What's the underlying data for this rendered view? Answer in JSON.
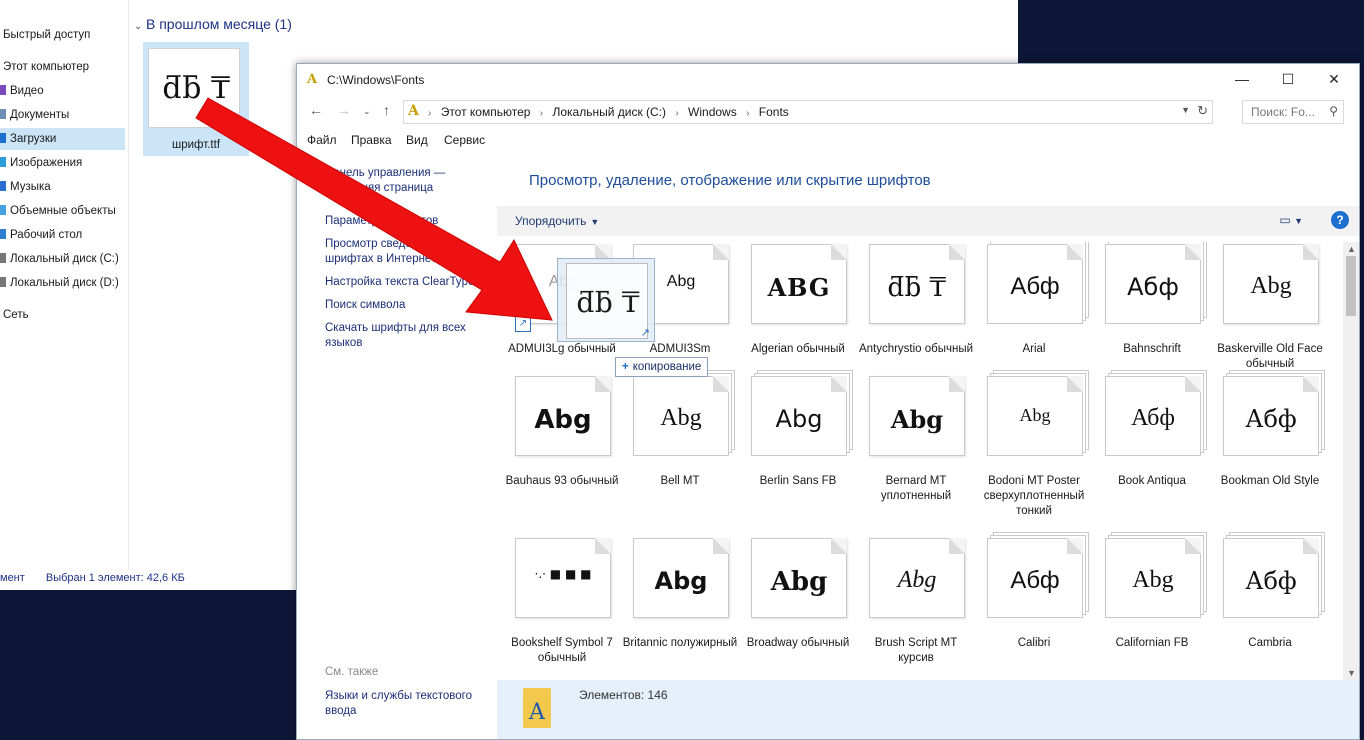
{
  "background_window": {
    "nav": [
      {
        "label": "Быстрый доступ",
        "color": "#f5b400"
      },
      {
        "label": "Этот компьютер",
        "color": "#5aa0e6"
      },
      {
        "label": "Видео",
        "color": "#7a4bbf"
      },
      {
        "label": "Документы",
        "color": "#6e8eb4"
      },
      {
        "label": "Загрузки",
        "color": "#1d6fd0"
      },
      {
        "label": "Изображения",
        "color": "#2d9cdb"
      },
      {
        "label": "Музыка",
        "color": "#2d6fd0"
      },
      {
        "label": "Объемные объекты",
        "color": "#45a0e0"
      },
      {
        "label": "Рабочий стол",
        "color": "#2d7fd0"
      },
      {
        "label": "Локальный диск (C:)",
        "color": "#777777"
      },
      {
        "label": "Локальный диск (D:)",
        "color": "#777777"
      },
      {
        "label": "Сеть",
        "color": "#3c7fd0"
      }
    ],
    "group_header": "В прошлом месяце (1)",
    "file": {
      "name": "шрифт.ttf",
      "preview": "ƌƃ ₸"
    },
    "status": {
      "count": "мент",
      "selection": "Выбран 1 элемент: 42,6 КБ"
    }
  },
  "fonts_window": {
    "title": "C:\\Windows\\Fonts",
    "title_icon": "A",
    "controls": {
      "minimize": "—",
      "maximize": "☐",
      "close": "✕"
    },
    "breadcrumb": [
      "Этот компьютер",
      "Локальный диск (C:)",
      "Windows",
      "Fonts"
    ],
    "search_placeholder": "Поиск: Fo...",
    "menu": [
      "Файл",
      "Правка",
      "Вид",
      "Сервис"
    ],
    "left_links": [
      "Панель управления — домашняя страница",
      "Параметры шрифтов",
      "Просмотр сведений о шрифтах в Интернете",
      "Настройка текста ClearType",
      "Поиск символа",
      "Скачать шрифты для всех языков"
    ],
    "see_also_label": "См. также",
    "see_also_links": [
      "Языки и службы текстового ввода"
    ],
    "heading": "Просмотр, удаление, отображение или скрытие шрифтов",
    "organize_label": "Упорядочить",
    "fonts": [
      {
        "name": "ADMUI3Lg обычный",
        "sample": "Abg",
        "family": "Liberation Sans",
        "style": "color:#999;font-size:16px",
        "stack": false,
        "shortcut": true
      },
      {
        "name": "ADMUI3Sm",
        "sample": "Abg",
        "family": "Liberation Sans",
        "style": "font-size:16px",
        "stack": false,
        "shortcut": false
      },
      {
        "name": "Algerian обычный",
        "sample": "ABG",
        "family": "DejaVu Serif",
        "style": "font-weight:bold;letter-spacing:1px",
        "stack": false,
        "shortcut": false
      },
      {
        "name": "Antychrystio обычный",
        "sample": "ƌƃ ₸",
        "family": "DejaVu Serif",
        "style": "font-size:26px",
        "stack": false,
        "shortcut": false
      },
      {
        "name": "Arial",
        "sample": "Абф",
        "family": "Liberation Sans",
        "style": "",
        "stack": true,
        "shortcut": false
      },
      {
        "name": "Bahnschrift",
        "sample": "Абф",
        "family": "DejaVu Sans",
        "style": "",
        "stack": true,
        "shortcut": false
      },
      {
        "name": "Baskerville Old Face обычный",
        "sample": "Abg",
        "family": "Liberation Serif",
        "style": "",
        "stack": false,
        "shortcut": false
      },
      {
        "name": "Bauhaus 93 обычный",
        "sample": "Abg",
        "family": "DejaVu Sans",
        "style": "font-weight:bold;font-size:26px",
        "stack": false,
        "shortcut": false
      },
      {
        "name": "Bell MT",
        "sample": "Abg",
        "family": "Liberation Serif",
        "style": "",
        "stack": true,
        "shortcut": false
      },
      {
        "name": "Berlin Sans FB",
        "sample": "Abg",
        "family": "DejaVu Sans",
        "style": "",
        "stack": true,
        "shortcut": false
      },
      {
        "name": "Bernard MT уплотненный",
        "sample": "Abg",
        "family": "DejaVu Serif",
        "style": "font-weight:bold",
        "stack": false,
        "shortcut": false
      },
      {
        "name": "Bodoni MT Poster сверхуплотненный тонкий",
        "sample": "Abg",
        "family": "Liberation Serif",
        "style": "font-size:18px",
        "stack": true,
        "shortcut": false
      },
      {
        "name": "Book Antiqua",
        "sample": "Абф",
        "family": "Liberation Serif",
        "style": "",
        "stack": true,
        "shortcut": false
      },
      {
        "name": "Bookman Old Style",
        "sample": "Абф",
        "family": "DejaVu Serif",
        "style": "",
        "stack": true,
        "shortcut": false
      },
      {
        "name": "Bookshelf Symbol 7 обычный",
        "sample": "·.·  ■  ■  ■",
        "family": "DejaVu Sans",
        "style": "font-size:12px",
        "stack": false,
        "shortcut": false
      },
      {
        "name": "Britannic полужирный",
        "sample": "Abg",
        "family": "DejaVu Sans",
        "style": "font-weight:bold",
        "stack": false,
        "shortcut": false
      },
      {
        "name": "Broadway обычный",
        "sample": "Abg",
        "family": "DejaVu Serif",
        "style": "font-weight:bold;font-size:26px",
        "stack": false,
        "shortcut": false
      },
      {
        "name": "Brush Script MT курсив",
        "sample": "Abg",
        "family": "Liberation Serif",
        "style": "font-style:italic",
        "stack": false,
        "shortcut": false
      },
      {
        "name": "Calibri",
        "sample": "Абф",
        "family": "Liberation Sans",
        "style": "",
        "stack": true,
        "shortcut": false
      },
      {
        "name": "Californian FB",
        "sample": "Abg",
        "family": "Liberation Serif",
        "style": "",
        "stack": true,
        "shortcut": false
      },
      {
        "name": "Cambria",
        "sample": "Абф",
        "family": "DejaVu Serif",
        "style": "",
        "stack": true,
        "shortcut": false
      }
    ],
    "drag": {
      "preview": "ƌƃ ₸",
      "tooltip_plus": "+",
      "tooltip": "копирование"
    },
    "details": {
      "icon": "A",
      "count_text": "Элементов: 146"
    }
  },
  "colors": {
    "arrow": "#ee1111",
    "link": "#1c2f78",
    "heading": "#1e4e9b",
    "selection": "#cce4f7"
  }
}
